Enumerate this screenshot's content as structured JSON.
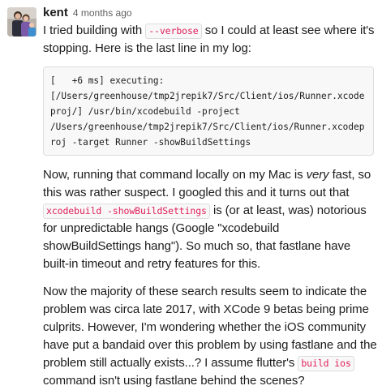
{
  "message": {
    "author": "kent",
    "timestamp": "4 months ago",
    "paragraph1": {
      "text_before": "I tried building with ",
      "code": "--verbose",
      "text_after": " so I could at least see where it's stopping. Here is the last line in my log:"
    },
    "code_block": {
      "lines": [
        "[   +6 ms] executing:",
        "[/Users/greenhouse/tmp2jrepik7/Src/Client/ios/Runner.xcode",
        "proj/] /usr/bin/xcodebuild -project",
        "/Users/greenhouse/tmp2jrepik7/Src/Client/ios/Runner.xcodep",
        "roj -target Runner -showBuildSettings"
      ]
    },
    "paragraph2": {
      "text_before": "Now, running that command locally on my Mac is ",
      "emphasis": "very",
      "text_mid": " fast, so this was rather suspect. I googled this and it turns out that ",
      "code": "xcodebuild -showBuildSettings",
      "text_after": " is (or at least, was) notorious for unpredictable hangs (Google \"xcodebuild showBuildSettings hang\"). So much so, that fastlane have built-in timeout and retry features for this."
    },
    "paragraph3": {
      "text_before": "Now the majority of these search results seem to indicate the problem was circa late 2017, with XCode 9 betas being prime culprits. However, I'm wondering whether the iOS community have put a bandaid over this problem by using fastlane and the problem still actually exists...? I assume flutter's ",
      "code": "build ios",
      "text_after": " command isn't using fastlane behind the scenes?"
    }
  }
}
